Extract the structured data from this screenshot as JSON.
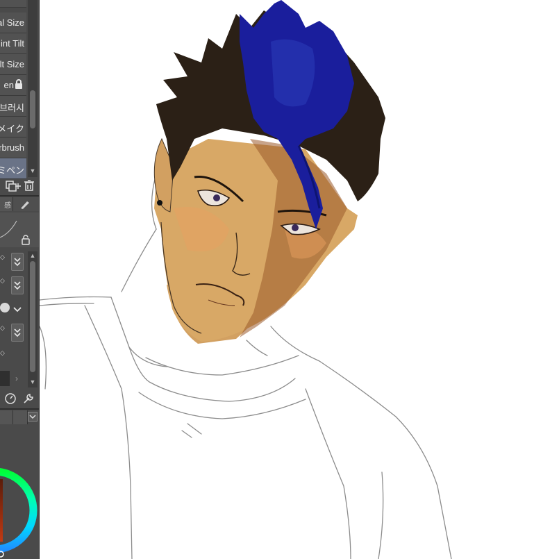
{
  "brushes": {
    "items": [
      {
        "label": "al Size"
      },
      {
        "label": "int Tilt"
      },
      {
        "label": "lt Size"
      },
      {
        "label": "en"
      },
      {
        "label": "브러시"
      },
      {
        "label": "リメイク"
      },
      {
        "label": "rbrush"
      },
      {
        "label": "ミペン"
      }
    ],
    "selected_index": 7
  },
  "sub_tool_tabs": [
    {
      "label": "感"
    }
  ],
  "colors": {
    "panel_bg": "#4a4a4a",
    "selected_item": "#6a7387",
    "hair_blue": "#1a1e9c",
    "hair_dark": "#2b2016",
    "skin": "#d8a866"
  },
  "icons": [
    "lock-icon",
    "copy-icon",
    "add-icon",
    "trash-icon",
    "brush-icon",
    "unlock-icon",
    "chevron-down-icon",
    "pressure-icon",
    "wrench-icon",
    "color-wheel"
  ]
}
